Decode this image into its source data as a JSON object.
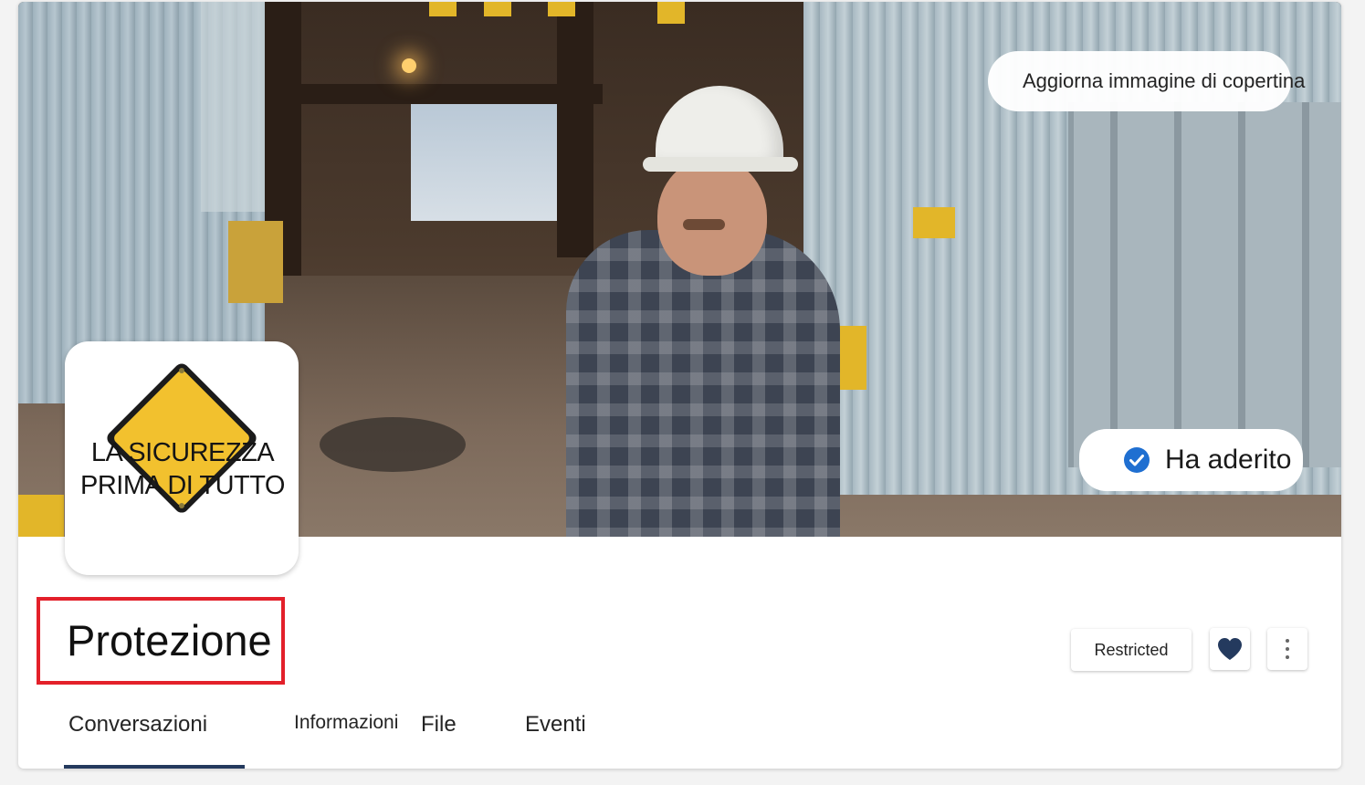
{
  "cover": {
    "update_cover_label": "Aggiorna immagine di copertina",
    "camera_icon": "camera-icon"
  },
  "membership": {
    "status_label": "Ha aderito",
    "status_icon": "check-circle-icon",
    "accent_color": "#1f6fd1"
  },
  "logo": {
    "line1": "LA SICUREZZA",
    "line2": "PRIMA DI TUTTO",
    "sign_color": "#f2c12e"
  },
  "group": {
    "title": "Protezione",
    "highlight_color": "#e3202a"
  },
  "actions": {
    "privacy_label": "Restricted",
    "favorite_icon": "heart-icon",
    "more_icon": "more-vertical-icon"
  },
  "tabs": [
    {
      "label": "Conversazioni",
      "active": true
    },
    {
      "label": "Informazioni",
      "active": false
    },
    {
      "label": "File",
      "active": false
    },
    {
      "label": "Eventi",
      "active": false
    }
  ]
}
